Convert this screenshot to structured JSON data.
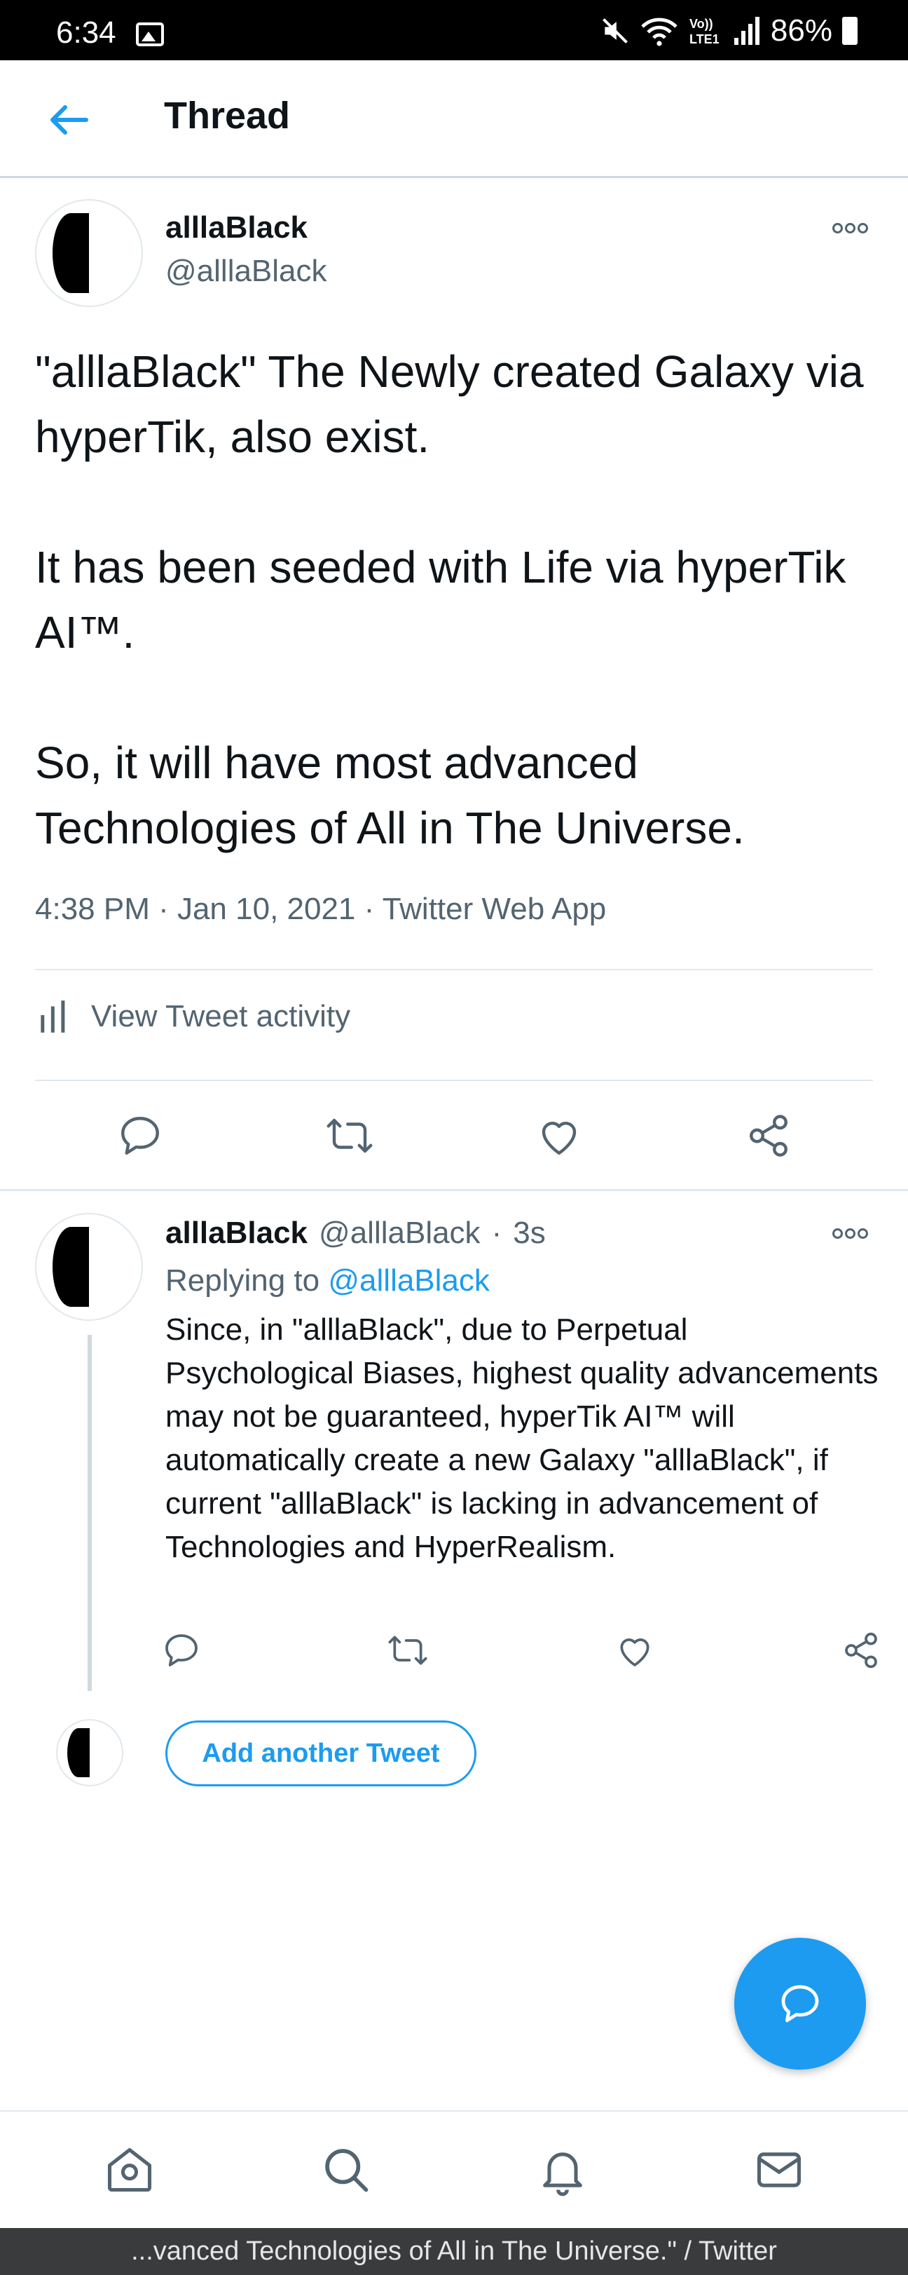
{
  "status_bar": {
    "time": "6:34",
    "battery": "86%"
  },
  "header": {
    "title": "Thread"
  },
  "main_tweet": {
    "display_name": "alllaBlack",
    "handle": "@alllaBlack",
    "text": "\"alllaBlack\" The Newly created Galaxy via hyperTik, also exist.\n\nIt has been seeded with Life via hyperTik AI™.\n\nSo, it will have most advanced Technologies of All in The Universe.",
    "meta": "4:38 PM · Jan 10, 2021 · Twitter Web App",
    "activity_label": "View Tweet activity"
  },
  "reply_tweet": {
    "display_name": "alllaBlack",
    "handle": "@alllaBlack",
    "dot": "·",
    "time": "3s",
    "replying_prefix": "Replying to",
    "replying_to": "@alllaBlack",
    "text": "Since, in \"alllaBlack\", due to Perpetual Psychological Biases, highest quality advancements may not be guaranteed, hyperTik AI™ will automatically create a new Galaxy \"alllaBlack\", if current \"alllaBlack\" is lacking in advancement of Technologies and HyperRealism."
  },
  "composer": {
    "add_button_label": "Add another Tweet"
  },
  "bottom_nav": [
    "home-icon",
    "search-icon",
    "notifications-icon",
    "messages-icon"
  ],
  "caption": "...vanced Technologies of All in The Universe.\" / Twitter",
  "colors": {
    "accent": "#1d9bf0",
    "secondary_text": "#536471",
    "divider": "#e1e8ed"
  }
}
